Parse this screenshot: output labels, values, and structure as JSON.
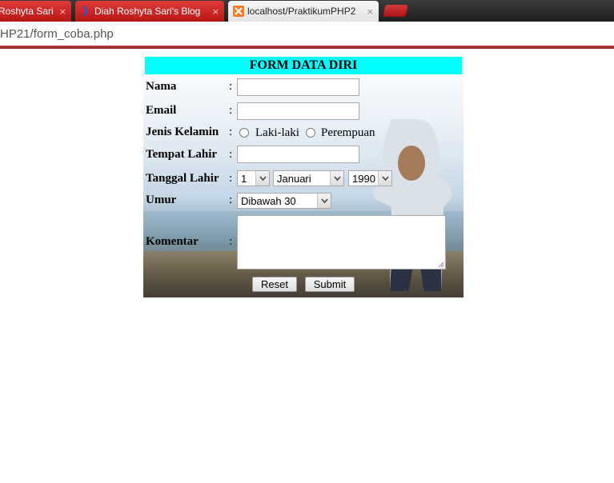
{
  "browser": {
    "tabs": [
      {
        "title": "Roshyta Sari",
        "style": "red"
      },
      {
        "title": "Diah Roshyta Sari's Blog",
        "style": "red"
      },
      {
        "title": "localhost/PraktikumPHP2",
        "style": "active"
      }
    ],
    "close_glyph": "×",
    "url": "HP21/form_coba.php"
  },
  "form": {
    "title": "FORM DATA DIRI",
    "colon": ":",
    "fields": {
      "nama_label": "Nama",
      "email_label": "Email",
      "jenis_kelamin_label": "Jenis Kelamin",
      "gender_options": [
        "Laki-laki",
        "Perempuan"
      ],
      "tempat_lahir_label": "Tempat Lahir",
      "tanggal_lahir_label": "Tanggal Lahir",
      "day_value": "1",
      "month_value": "Januari",
      "year_value": "1990",
      "umur_label": "Umur",
      "umur_value": "Dibawah 30",
      "komentar_label": "Komentar"
    },
    "buttons": {
      "reset": "Reset",
      "submit": "Submit"
    }
  },
  "colors": {
    "header_bg": "#00ffff",
    "tab_red": "#c91f1f"
  }
}
